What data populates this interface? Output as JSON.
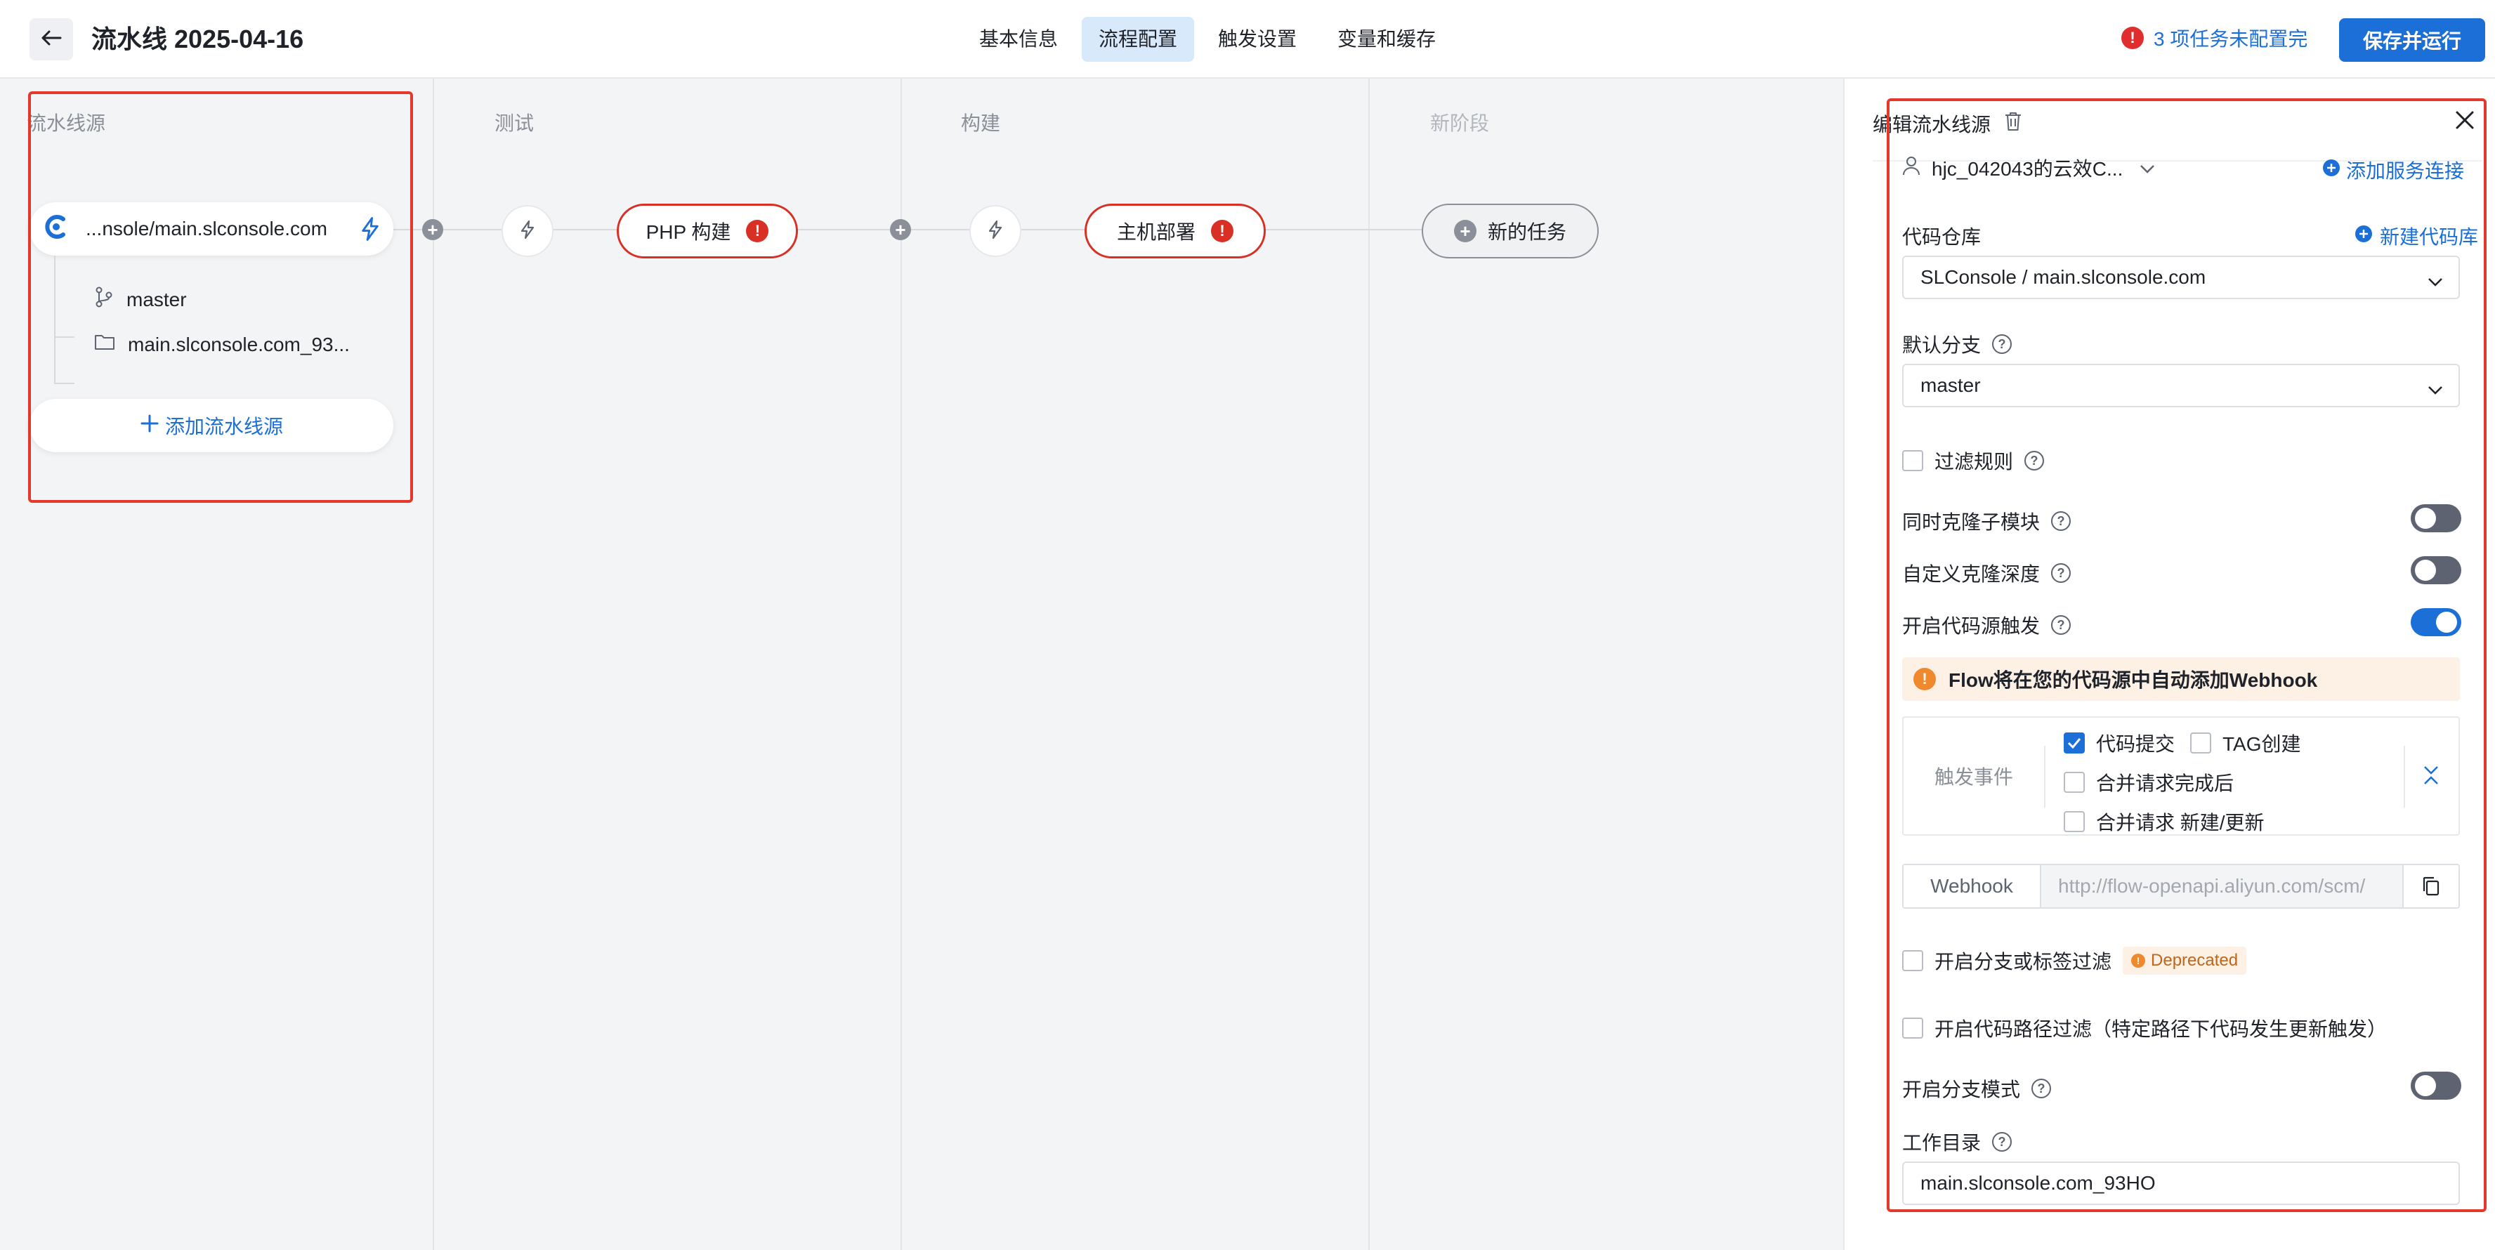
{
  "header": {
    "title": "流水线 2025-04-16",
    "tabs": [
      {
        "label": "基本信息",
        "active": false
      },
      {
        "label": "流程配置",
        "active": true
      },
      {
        "label": "触发设置",
        "active": false
      },
      {
        "label": "变量和缓存",
        "active": false
      }
    ],
    "alert_text": "3 项任务未配置完",
    "alert_icon": "!",
    "save_run_label": "保存并运行"
  },
  "stages": {
    "source_label": "流水线源",
    "test_label": "测试",
    "build_label": "构建",
    "new_stage_label": "新阶段"
  },
  "source": {
    "repo_name": "...nsole/main.slconsole.com",
    "branch": "master",
    "workdir": "main.slconsole.com_93...",
    "add_label": "添加流水线源"
  },
  "jobs": {
    "php_build": "PHP 构建",
    "host_deploy": "主机部署",
    "new_task": "新的任务",
    "error_mark": "!",
    "plus_mark": "+"
  },
  "panel": {
    "title": "编辑流水线源",
    "connection": "hjc_042043的云效C...",
    "add_connection": "添加服务连接",
    "repo_label": "代码仓库",
    "new_repo": "新建代码库",
    "repo_value": "SLConsole / main.slconsole.com",
    "branch_label": "默认分支",
    "branch_value": "master",
    "filter_rules": "过滤规则",
    "clone_submodule": "同时克隆子模块",
    "clone_depth": "自定义克隆深度",
    "code_trigger": "开启代码源触发",
    "notice": "Flow将在您的代码源中自动添加Webhook",
    "notice_icon": "!",
    "events_label": "触发事件",
    "events": [
      {
        "label": "代码提交",
        "checked": true
      },
      {
        "label": "TAG创建",
        "checked": false
      },
      {
        "label": "合并请求完成后",
        "checked": false
      },
      {
        "label": "合并请求 新建/更新",
        "checked": false
      }
    ],
    "webhook_label": "Webhook",
    "webhook_value": "http://flow-openapi.aliyun.com/scm/",
    "branch_tag_filter": "开启分支或标签过滤",
    "deprecated": "Deprecated",
    "path_filter": "开启代码路径过滤（特定路径下代码发生更新触发）",
    "branch_mode": "开启分支模式",
    "workdir_label": "工作目录",
    "workdir_value": "main.slconsole.com_93HO",
    "question_mark": "?"
  },
  "colors": {
    "accent": "#1b6fd6",
    "error": "#d93026",
    "highlight": "#e3392c",
    "warning": "#f0892e"
  }
}
